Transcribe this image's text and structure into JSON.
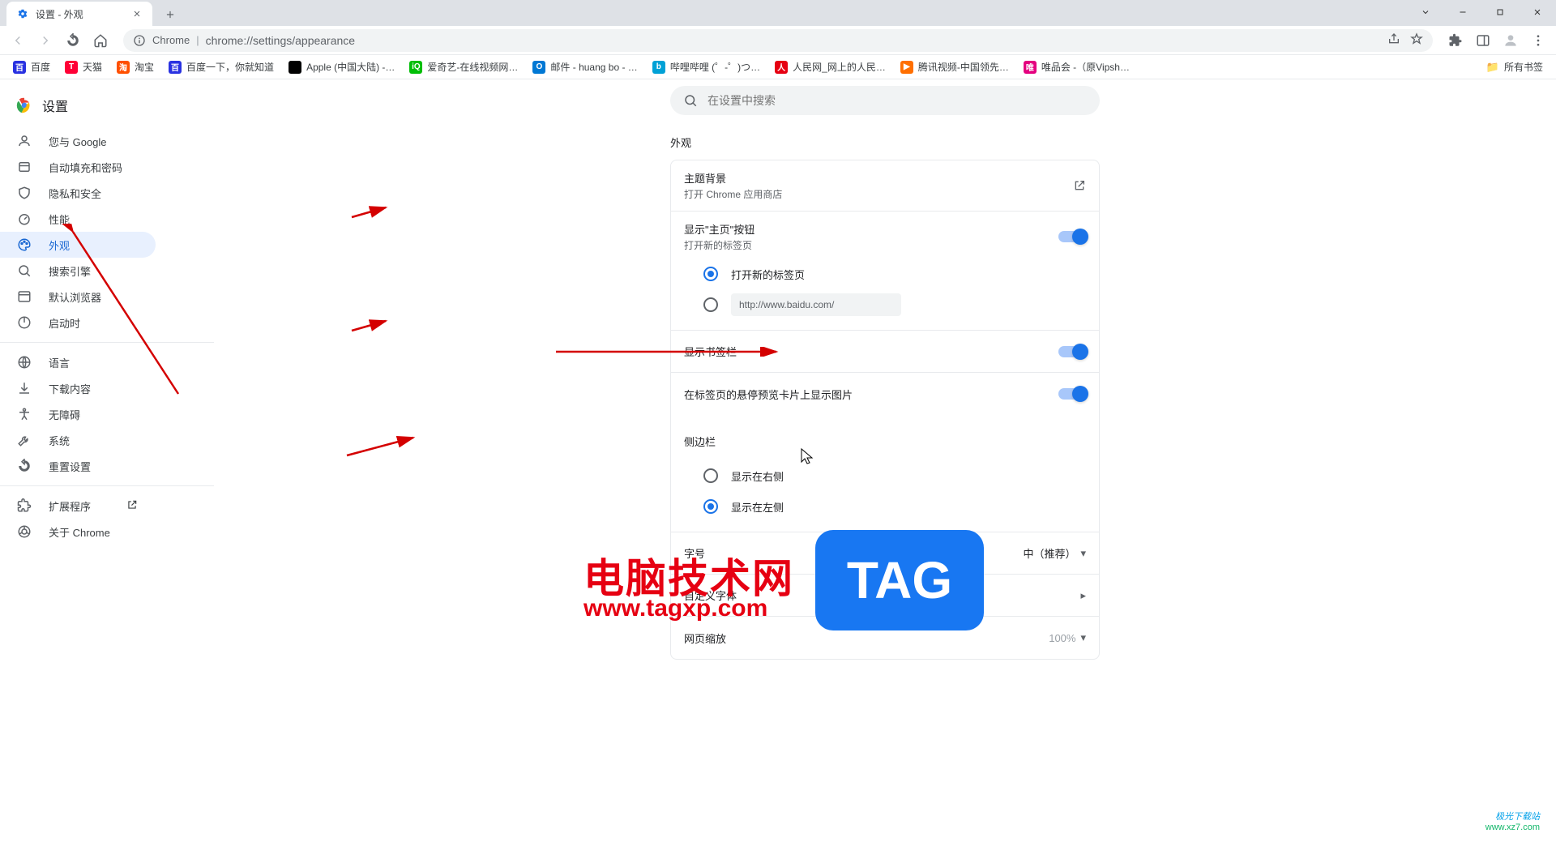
{
  "tab": {
    "title": "设置 - 外观"
  },
  "omnibox": {
    "origin": "Chrome",
    "url": "chrome://settings/appearance"
  },
  "bookmarks": [
    {
      "label": "百度",
      "bg": "#2932e1",
      "fg": "#fff",
      "char": "百"
    },
    {
      "label": "天猫",
      "bg": "#ff0036",
      "fg": "#fff",
      "char": "T"
    },
    {
      "label": "淘宝",
      "bg": "#ff5000",
      "fg": "#fff",
      "char": "淘"
    },
    {
      "label": "百度一下，你就知道",
      "bg": "#2932e1",
      "fg": "#fff",
      "char": "百"
    },
    {
      "label": "Apple (中国大陆) -…",
      "bg": "#000",
      "fg": "#fff",
      "char": ""
    },
    {
      "label": "爱奇艺-在线视频网…",
      "bg": "#00be06",
      "fg": "#fff",
      "char": "iQ"
    },
    {
      "label": "邮件 - huang bo - …",
      "bg": "#0078d4",
      "fg": "#fff",
      "char": "O"
    },
    {
      "label": "哔哩哔哩 (゜-゜)つ…",
      "bg": "#00a1d6",
      "fg": "#fff",
      "char": "b"
    },
    {
      "label": "人民网_网上的人民…",
      "bg": "#e60012",
      "fg": "#fff",
      "char": "人"
    },
    {
      "label": "腾讯视频-中国领先…",
      "bg": "#ff6f00",
      "fg": "#fff",
      "char": "▶"
    },
    {
      "label": "唯品会 -（原Vipsh…",
      "bg": "#e4007f",
      "fg": "#fff",
      "char": "唯"
    }
  ],
  "all_bookmarks_label": "所有书签",
  "app_title": "设置",
  "nav": [
    {
      "label": "您与 Google",
      "icon": "person"
    },
    {
      "label": "自动填充和密码",
      "icon": "autofill"
    },
    {
      "label": "隐私和安全",
      "icon": "shield"
    },
    {
      "label": "性能",
      "icon": "speed"
    },
    {
      "label": "外观",
      "icon": "palette",
      "active": true
    },
    {
      "label": "搜索引擎",
      "icon": "search"
    },
    {
      "label": "默认浏览器",
      "icon": "browser"
    },
    {
      "label": "启动时",
      "icon": "power"
    }
  ],
  "nav2": [
    {
      "label": "语言",
      "icon": "globe"
    },
    {
      "label": "下载内容",
      "icon": "download"
    },
    {
      "label": "无障碍",
      "icon": "a11y"
    },
    {
      "label": "系统",
      "icon": "wrench"
    },
    {
      "label": "重置设置",
      "icon": "reset"
    }
  ],
  "nav3": [
    {
      "label": "扩展程序",
      "icon": "ext",
      "launch": true
    },
    {
      "label": "关于 Chrome",
      "icon": "chrome"
    }
  ],
  "search_placeholder": "在设置中搜索",
  "section_title": "外观",
  "rows": {
    "theme": {
      "title": "主题背景",
      "sub": "打开 Chrome 应用商店"
    },
    "home_button": {
      "title": "显示\"主页\"按钮",
      "sub": "打开新的标签页"
    },
    "home_radio_newtab": "打开新的标签页",
    "home_radio_url": "http://www.baidu.com/",
    "bookmarks_bar": "显示书签栏",
    "hover_card": "在标签页的悬停预览卡片上显示图片",
    "side_panel": "侧边栏",
    "side_right": "显示在右侧",
    "side_left": "显示在左侧",
    "font_size": {
      "label": "字号",
      "value": "中（推荐）"
    },
    "custom_font": "自定义字体",
    "page_zoom": {
      "label": "网页缩放",
      "value": "100%"
    }
  },
  "overlay": {
    "big_text": "电脑技术网",
    "big_url": "www.tagxp.com",
    "tag_text": "TAG",
    "watermark_brand": "极光下载站",
    "watermark_url": "www.xz7.com"
  }
}
